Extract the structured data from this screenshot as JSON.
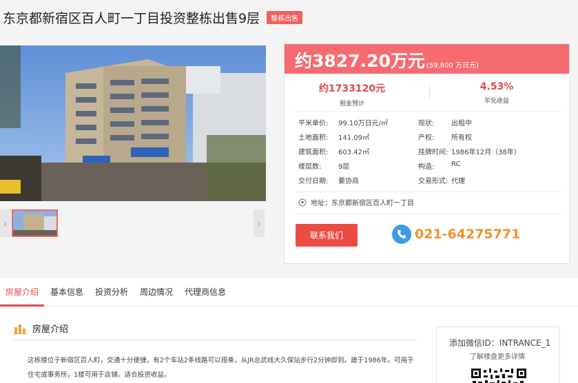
{
  "header": {
    "title": "东京都新宿区百人町一丁目投资整栋出售9层",
    "badge": "整栋出售"
  },
  "gallery": {
    "prev_icon": "chevron-left-icon",
    "next_icon": "chevron-right-icon",
    "prev_glyph": "‹",
    "next_glyph": "›"
  },
  "price": {
    "main": "约3827.20万元",
    "sub": "(59,800 万日元)"
  },
  "kpis": [
    {
      "value": "约1733120元",
      "label": "租金预计"
    },
    {
      "value": "4.53%",
      "label": "年化收益"
    }
  ],
  "specs": [
    {
      "label": "平米单价:",
      "value": "99.10万日元/㎡",
      "label2": "现状:",
      "value2": "出租中"
    },
    {
      "label": "土地面积:",
      "value": "141.09㎡",
      "label2": "产权:",
      "value2": "所有权"
    },
    {
      "label": "建筑面积:",
      "value": "603.42㎡",
      "label2": "挂牌时间:",
      "value2": "1986年12月（38年）"
    },
    {
      "label": "楼层数:",
      "value": "9层",
      "label2": "构造:",
      "value2": "RC"
    },
    {
      "label": "交付日期:",
      "value": "要协商",
      "label2": "交易形式:",
      "value2": "代理"
    }
  ],
  "address": "地址：东京都新宿区百人町一丁目",
  "contact": {
    "button": "联系我们",
    "phone": "021-64275771"
  },
  "tabs": [
    "房屋介绍",
    "基本信息",
    "投资分析",
    "周边情况",
    "代理商信息"
  ],
  "section": {
    "title": "房屋介绍",
    "description": "这栋楼位于新宿区百人町，交通十分便捷，有2个车站2条线路可以搭乘，从JR总武线大久保站步行2分钟即到。建于1986年。可用于住宅或事务所，1楼可用于店铺。适合投资收益。"
  },
  "wechat": {
    "id": "添加微信ID：INTRANCE_1",
    "sub": "了解楼盘更多详情"
  },
  "colors": {
    "accent": "#f66b6f",
    "button": "#ea4c44",
    "phone": "#f0922d",
    "tab_active": "#e44c4c"
  }
}
